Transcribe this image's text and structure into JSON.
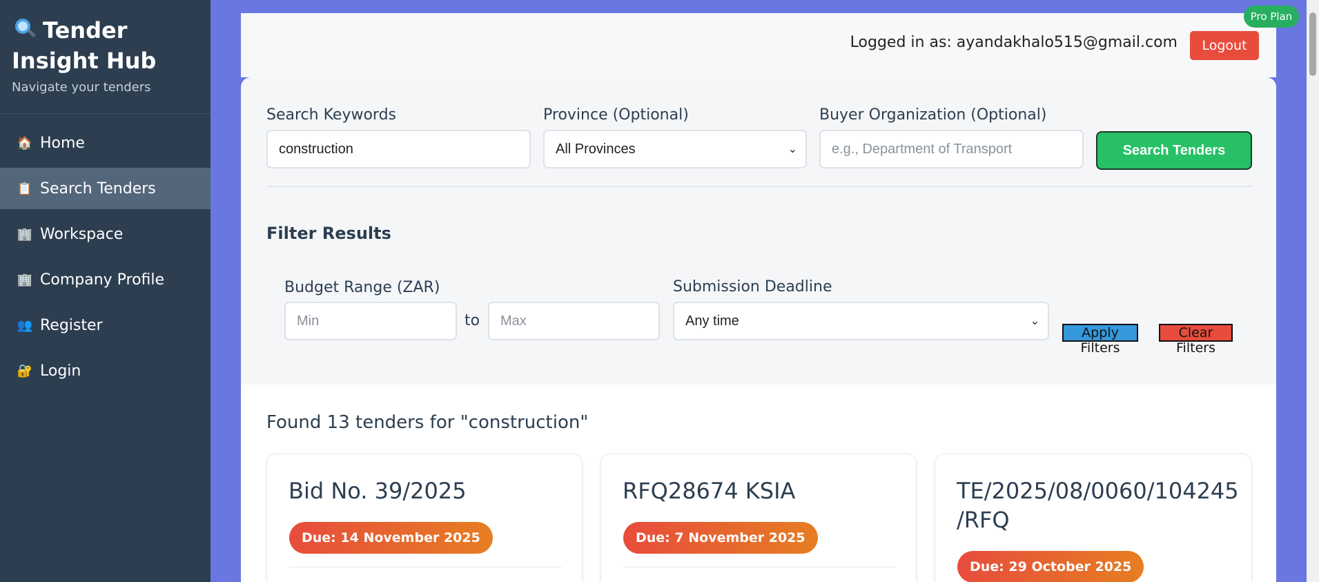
{
  "sidebar": {
    "brand_title": "Tender Insight Hub",
    "brand_subtitle": "Navigate your tenders",
    "items": [
      {
        "label": "Home",
        "icon": "🏠",
        "active": false
      },
      {
        "label": "Search Tenders",
        "icon": "📋",
        "active": true
      },
      {
        "label": "Workspace",
        "icon": "🏢",
        "active": false
      },
      {
        "label": "Company Profile",
        "icon": "🏢",
        "active": false
      },
      {
        "label": "Register",
        "icon": "👥",
        "active": false
      },
      {
        "label": "Login",
        "icon": "🔐",
        "active": false
      }
    ]
  },
  "header": {
    "logged_in_text": "Logged in as: ayandakhalo515@gmail.com",
    "logout_label": "Logout",
    "plan_badge": "Pro Plan"
  },
  "search": {
    "keywords_label": "Search Keywords",
    "keywords_value": "construction",
    "province_label": "Province (Optional)",
    "province_value": "All Provinces",
    "buyer_label": "Buyer Organization (Optional)",
    "buyer_placeholder": "e.g., Department of Transport",
    "search_button": "Search Tenders"
  },
  "filters": {
    "title": "Filter Results",
    "budget_label": "Budget Range (ZAR)",
    "min_placeholder": "Min",
    "to_label": "to",
    "max_placeholder": "Max",
    "deadline_label": "Submission Deadline",
    "deadline_value": "Any time",
    "apply_button": "Apply Filters",
    "clear_button": "Clear Filters"
  },
  "results": {
    "summary": "Found 13 tenders for \"construction\"",
    "cards": [
      {
        "title": "Bid No. 39/2025",
        "due": "Due: 14 November 2025"
      },
      {
        "title": "RFQ28674 KSIA",
        "due": "Due: 7 November 2025"
      },
      {
        "title": "TE/2025/08/0060/104245 /RFQ",
        "due": "Due: 29 October 2025"
      }
    ]
  },
  "colors": {
    "sidebar_bg": "#2c3e50",
    "page_bg": "#6a77e0",
    "accent_green": "#27c066",
    "danger_red": "#e74c3c",
    "apply_blue": "#3498db"
  }
}
